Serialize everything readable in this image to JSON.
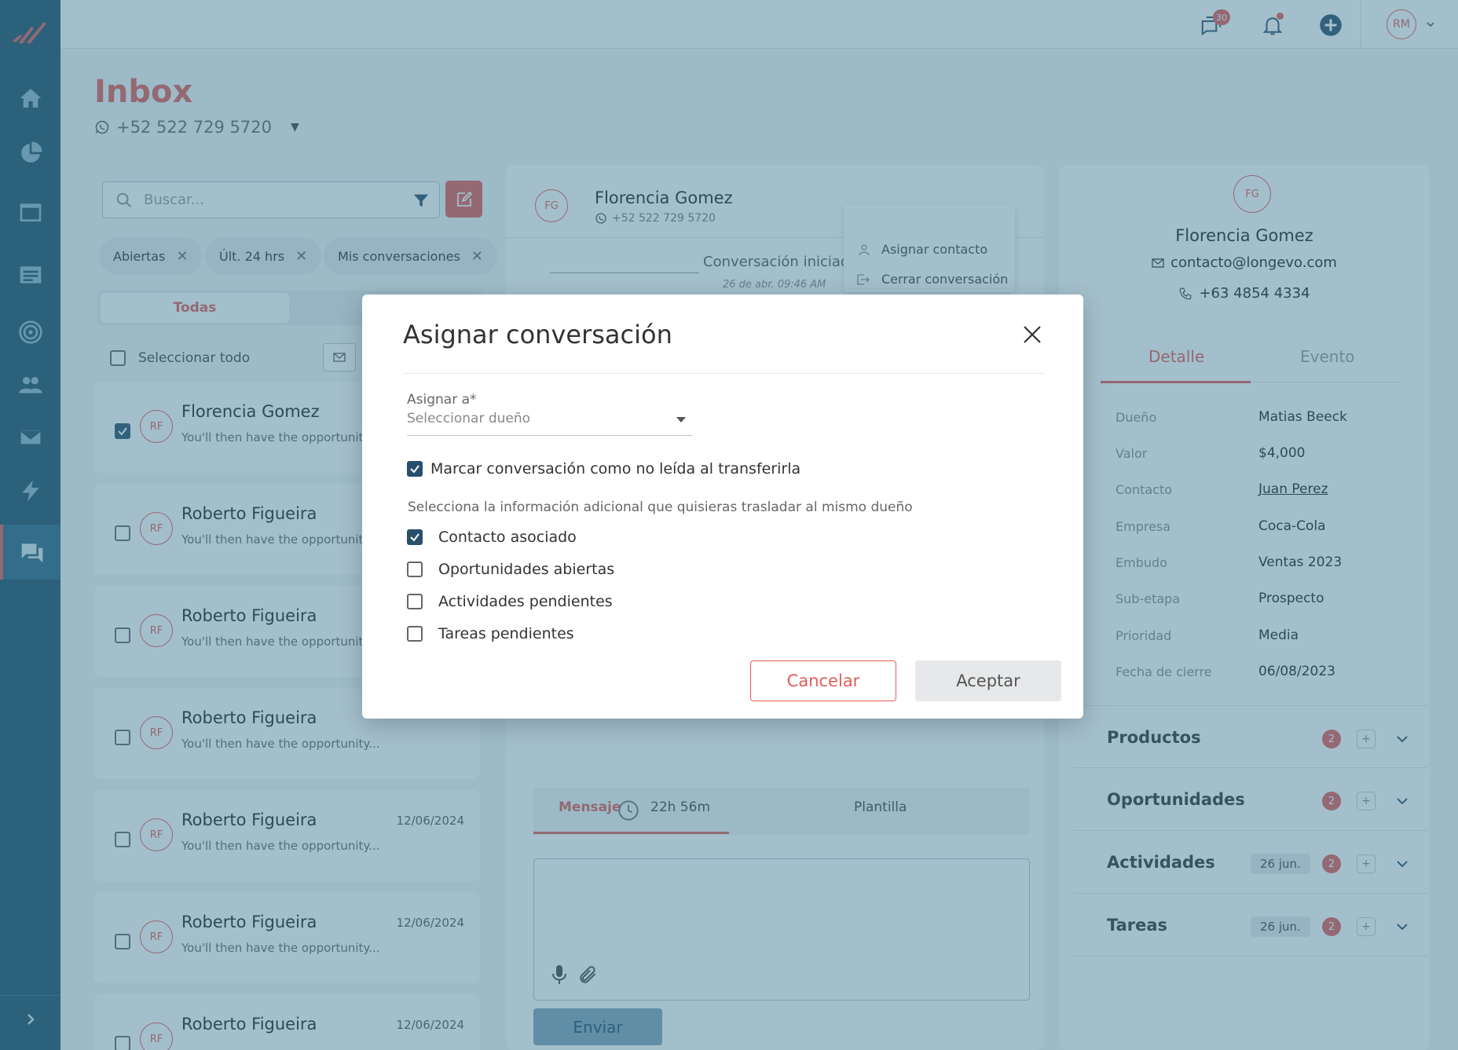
{
  "sidebar": {
    "items": [
      {
        "name": "home-icon"
      },
      {
        "name": "pie-chart-icon"
      },
      {
        "name": "calendar-icon"
      },
      {
        "name": "notes-icon"
      },
      {
        "name": "target-icon"
      },
      {
        "name": "contacts-icon"
      },
      {
        "name": "mail-icon"
      },
      {
        "name": "automation-icon"
      },
      {
        "name": "inbox-chat-icon",
        "active": true
      }
    ]
  },
  "topbar": {
    "chat_badge": "30",
    "user_initials": "RM"
  },
  "header": {
    "title": "Inbox",
    "phone": "+52 522 729 5720"
  },
  "left": {
    "search_placeholder": "Buscar...",
    "chips": [
      "Abiertas",
      "Últ. 24 hrs",
      "Mis conversaciones"
    ],
    "tab": "Todas",
    "select_all": "Seleccionar todo",
    "conversations": [
      {
        "initials": "RF",
        "name": "Florencia Gomez",
        "preview": "You'll then have the opportunit...",
        "date": "",
        "checked": true
      },
      {
        "initials": "RF",
        "name": "Roberto Figueira",
        "preview": "You'll then have the opportunity...",
        "date": "",
        "checked": false
      },
      {
        "initials": "RF",
        "name": "Roberto Figueira",
        "preview": "You'll then have the opportunity...",
        "date": "",
        "checked": false
      },
      {
        "initials": "RF",
        "name": "Roberto Figueira",
        "preview": "You'll then have the opportunity...",
        "date": "",
        "checked": false
      },
      {
        "initials": "RF",
        "name": "Roberto Figueira",
        "preview": "You'll then have the opportunity...",
        "date": "12/06/2024",
        "checked": false
      },
      {
        "initials": "RF",
        "name": "Roberto Figueira",
        "preview": "You'll then have the opportunity...",
        "date": "12/06/2024",
        "checked": false
      },
      {
        "initials": "RF",
        "name": "Roberto Figueira",
        "preview": "You'll then have the opportunity...",
        "date": "12/06/2024",
        "checked": false
      }
    ]
  },
  "middle": {
    "initials": "FG",
    "name": "Florencia Gomez",
    "phone": "+52 522 729 5720",
    "started_text": "Conversación iniciada",
    "started_date": "26 de abr. 09:46 AM",
    "dropdown": {
      "assign_contact": "Asignar contacto",
      "close_conversation": "Cerrar conversación"
    },
    "composer": {
      "tab_message": "Mensaje",
      "timer": "22h 56m",
      "tab_template": "Plantilla",
      "send": "Enviar"
    }
  },
  "right": {
    "initials": "FG",
    "name": "Florencia Gomez",
    "email": "contacto@longevo.com",
    "phone": "+63 4854 4334",
    "tabs": [
      "Detalle",
      "Evento"
    ],
    "details": [
      {
        "label": "Dueño",
        "value": "Matias Beeck"
      },
      {
        "label": "Valor",
        "value": "$4,000"
      },
      {
        "label": "Contacto",
        "value": "Juan Perez"
      },
      {
        "label": "Empresa",
        "value": "Coca-Cola"
      },
      {
        "label": "Embudo",
        "value": "Ventas 2023"
      },
      {
        "label": "Sub-etapa",
        "value": "Prospecto"
      },
      {
        "label": "Prioridad",
        "value": "Media"
      },
      {
        "label": "Fecha de cierre",
        "value": "06/08/2023"
      }
    ],
    "sections": [
      {
        "title": "Productos",
        "count": "2",
        "date": ""
      },
      {
        "title": "Oportunidades",
        "count": "2",
        "date": ""
      },
      {
        "title": "Actividades",
        "count": "2",
        "date": "26 jun."
      },
      {
        "title": "Tareas",
        "count": "2",
        "date": "26 jun."
      }
    ]
  },
  "modal": {
    "title": "Asignar conversación",
    "field_label": "Asignar a*",
    "field_placeholder": "Seleccionar dueño",
    "mark_unread": "Marcar conversación como no leída al transferirla",
    "note": "Selecciona la información adicional que quisieras trasladar al mismo dueño",
    "options": [
      {
        "label": "Contacto asociado",
        "checked": true
      },
      {
        "label": "Oportunidades abiertas",
        "checked": false
      },
      {
        "label": "Actividades pendientes",
        "checked": false
      },
      {
        "label": "Tareas pendientes",
        "checked": false
      }
    ],
    "cancel": "Cancelar",
    "accept": "Aceptar"
  },
  "colors": {
    "accent": "#e35d59",
    "sidebar": "#1f4e69",
    "overlay": "#3c7891"
  }
}
